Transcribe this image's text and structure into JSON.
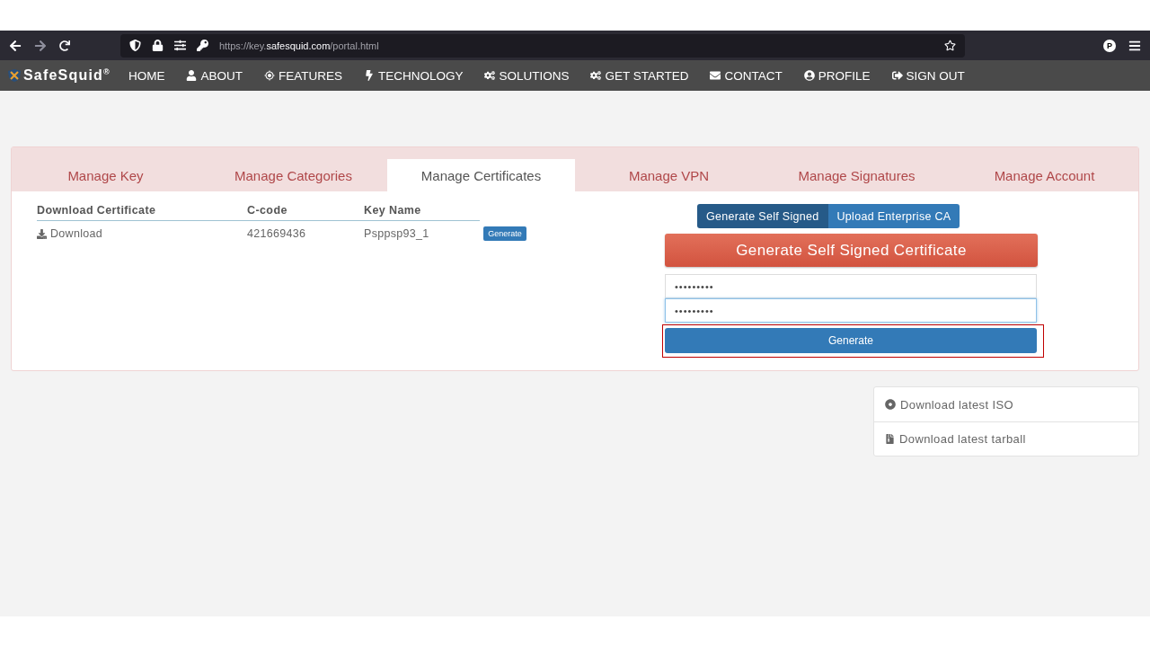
{
  "browser": {
    "url_host": "https://key.",
    "url_domain": "safesquid.com",
    "url_path": "/portal.html",
    "profile_initial": "P"
  },
  "navbar": {
    "brand": "SafeSquid",
    "brand_mark": "®",
    "items": [
      {
        "label": "HOME"
      },
      {
        "label": "ABOUT"
      },
      {
        "label": "FEATURES"
      },
      {
        "label": "TECHNOLOGY"
      },
      {
        "label": "SOLUTIONS"
      },
      {
        "label": "GET STARTED"
      },
      {
        "label": "CONTACT"
      },
      {
        "label": "PROFILE"
      },
      {
        "label": "SIGN OUT"
      }
    ]
  },
  "tabs": [
    {
      "label": "Manage Key",
      "selected": false
    },
    {
      "label": "Manage Categories",
      "selected": false
    },
    {
      "label": "Manage Certificates",
      "selected": true
    },
    {
      "label": "Manage VPN",
      "selected": false
    },
    {
      "label": "Manage Signatures",
      "selected": false
    },
    {
      "label": "Manage Account",
      "selected": false
    }
  ],
  "table": {
    "columns": [
      "Download Certificate",
      "C-code",
      "Key Name"
    ],
    "rows": [
      {
        "download": "Download",
        "c_code": "421669436",
        "key_name": "Psppsp93_1",
        "action": "Generate"
      }
    ]
  },
  "mode_toggle": [
    {
      "label": "Generate Self Signed",
      "selected": true
    },
    {
      "label": "Upload Enterprise CA",
      "selected": false
    }
  ],
  "form": {
    "heading": "Generate Self Signed Certificate",
    "fields": [
      {
        "value": "•••••••••",
        "focused": false
      },
      {
        "value": "•••••••••",
        "focused": true
      }
    ],
    "submit": {
      "label": "Generate",
      "highlighted": true
    }
  },
  "downloads": [
    {
      "label": "Download latest ISO"
    },
    {
      "label": "Download latest tarball"
    }
  ]
}
